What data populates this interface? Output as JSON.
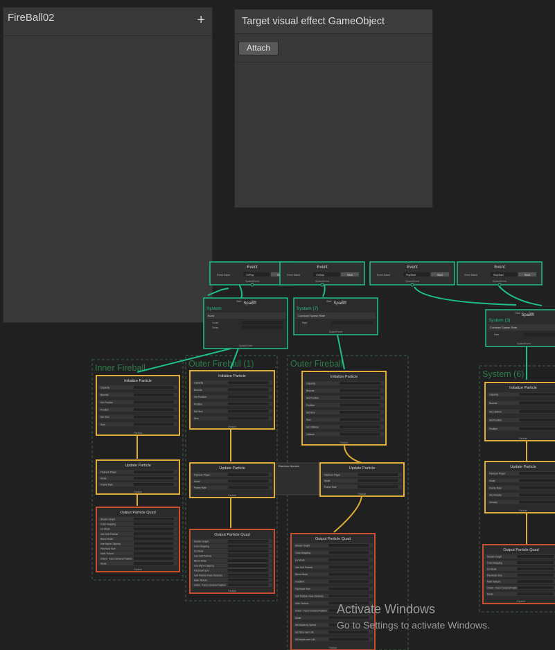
{
  "blackboard": {
    "title": "FireBall02",
    "add_icon": "plus-icon"
  },
  "target": {
    "title": "Target visual effect GameObject",
    "attach_label": "Attach"
  },
  "colors": {
    "event": "#1fbf8a",
    "context": "#e0ae38",
    "group_border": "#3f5f45",
    "group_title": "#2e7a4a",
    "output_border": "#c84e2e"
  },
  "events": [
    {
      "title": "Event",
      "field_label": "Event Name",
      "field_value": "OnPlay",
      "button": "Send",
      "port": "SpawnEvent"
    },
    {
      "title": "Event",
      "field_label": "Event Name",
      "field_value": "OnStop",
      "button": "Send",
      "port": "SpawnEvent"
    },
    {
      "title": "Event",
      "field_label": "Event Name",
      "field_value": "PlayStart",
      "button": "Send",
      "port": "SpawnEvent"
    },
    {
      "title": "Event",
      "field_label": "Event Name",
      "field_value": "StopStart",
      "button": "Send",
      "port": "SpawnEvent"
    }
  ],
  "spawn_ports": {
    "start": "Start",
    "stop": "Stop"
  },
  "spawns": [
    {
      "system": "System",
      "title": "Spawn",
      "block": "Burst",
      "rows": [
        "Count",
        "Delay"
      ],
      "port": "SpawnEvent"
    },
    {
      "system": "System (7)",
      "title": "Spawn",
      "block": "Constant Spawn Rate",
      "rows": [
        "Rate"
      ],
      "port": "SpawnEvent"
    },
    {
      "system": "System (3)",
      "title": "Spawn",
      "block": "Constant Spawn Rate",
      "rows": [
        "Rate"
      ],
      "port": "SpawnEvent"
    }
  ],
  "groups": [
    "Inner Fireball",
    "Outer Fireball (1)",
    "Outer Fireball",
    "System (6)"
  ],
  "contexts": {
    "initialize": "Initialize Particle",
    "update": "Update Particle",
    "output": "Output Particle Quad",
    "port": "Particle"
  },
  "blocks": {
    "capacity": "Capacity",
    "bounds": "Bounds",
    "set_position": "Set Position",
    "position": "Position",
    "set_size": "Set Size",
    "size": "Size",
    "set_lifetime": "Set Lifetime",
    "lifetime": "Lifetime",
    "flipbook": "Flipbook Player",
    "mode": "Mode",
    "frame_rate": "Frame Rate",
    "set_velocity": "Set Velocity",
    "velocity": "Velocity",
    "orient": "Orient : Face Camera Position",
    "face_mode": "Face Camera Position",
    "shader_graph": "Shader Graph",
    "sg_value": "None (Shader Graph Vfx Asset)",
    "color_mapping": "Color Mapping",
    "uv_mode": "Uv Mode",
    "use_soft": "Use Soft Particle",
    "blend_mode": "Blend Mode",
    "alpha_clip": "Use Alpha Clipping",
    "flipbook_size": "Flip Book Size",
    "soft_fade": "Soft Particle Fade Distance",
    "main_texture": "Main Texture",
    "texture_value": "FireBall02.png",
    "gradient": "Gradient",
    "size_over_life": "Set Size over Life",
    "size_by_speed": "Set Alpha by Speed",
    "alpha_over_life": "Set Alpha over Life",
    "random_number": "Random Number"
  },
  "watermark": {
    "title": "Activate Windows",
    "subtitle": "Go to Settings to activate Windows."
  }
}
